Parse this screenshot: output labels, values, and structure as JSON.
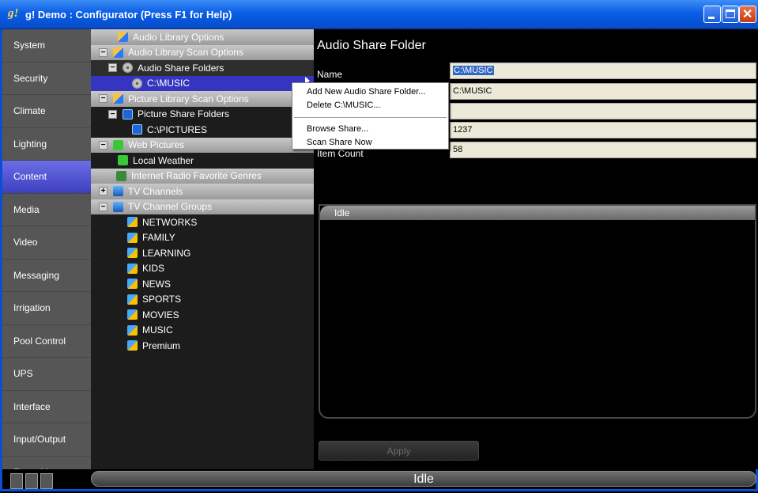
{
  "window": {
    "logo": "g!",
    "title": "g! Demo : Configurator   (Press F1 for Help)",
    "controls": [
      "minimize",
      "maximize",
      "close"
    ]
  },
  "nav": {
    "items": [
      {
        "label": "System"
      },
      {
        "label": "Security"
      },
      {
        "label": "Climate"
      },
      {
        "label": "Lighting"
      },
      {
        "label": "Content",
        "active": true
      },
      {
        "label": "Media"
      },
      {
        "label": "Video"
      },
      {
        "label": "Messaging"
      },
      {
        "label": "Irrigation"
      },
      {
        "label": "Pool Control"
      },
      {
        "label": "UPS"
      },
      {
        "label": "Interface"
      },
      {
        "label": "Input/Output"
      },
      {
        "label": "Event Mapper"
      }
    ]
  },
  "tree": {
    "rows": [
      {
        "label": "Audio Library Options",
        "style": "hdr",
        "indent": 34,
        "icon": "folder-icon"
      },
      {
        "label": "Audio Library Scan Options",
        "style": "hdr",
        "indent": 10,
        "expander": "−",
        "icon": "folder-icon"
      },
      {
        "label": "Audio Share Folders",
        "style": "subhdr",
        "indent": 22,
        "expander": "−",
        "icon": "cd-icon"
      },
      {
        "label": "C:\\MUSIC",
        "style": "sel",
        "indent": 52,
        "icon": "cd-icon"
      },
      {
        "label": "Picture Library Scan Options",
        "style": "hdr",
        "indent": 10,
        "expander": "−",
        "icon": "folder-icon"
      },
      {
        "label": "Picture Share Folders",
        "style": "plain",
        "indent": 22,
        "expander": "−",
        "icon": "picture-icon"
      },
      {
        "label": "C:\\PICTURES",
        "style": "plain",
        "indent": 52,
        "icon": "picture-icon"
      },
      {
        "label": "Web Pictures",
        "style": "hdr",
        "indent": 10,
        "expander": "−",
        "icon": "web-icon"
      },
      {
        "label": "Local Weather",
        "style": "plain",
        "indent": 34,
        "icon": "web-icon"
      },
      {
        "label": "Internet Radio Favorite Genres",
        "style": "hdr",
        "indent": 32,
        "icon": "radio-icon"
      },
      {
        "label": "TV Channels",
        "style": "hdr",
        "indent": 10,
        "expander": "+",
        "icon": "tv-icon"
      },
      {
        "label": "TV Channel Groups",
        "style": "hdr",
        "indent": 10,
        "expander": "−",
        "icon": "tv-icon"
      },
      {
        "label": "NETWORKS",
        "style": "plain",
        "indent": 46,
        "icon": "network-icon"
      },
      {
        "label": "FAMILY",
        "style": "plain",
        "indent": 46,
        "icon": "network-icon"
      },
      {
        "label": "LEARNING",
        "style": "plain",
        "indent": 46,
        "icon": "network-icon"
      },
      {
        "label": "KIDS",
        "style": "plain",
        "indent": 46,
        "icon": "network-icon"
      },
      {
        "label": "NEWS",
        "style": "plain",
        "indent": 46,
        "icon": "network-icon"
      },
      {
        "label": "SPORTS",
        "style": "plain",
        "indent": 46,
        "icon": "network-icon"
      },
      {
        "label": "MOVIES",
        "style": "plain",
        "indent": 46,
        "icon": "network-icon"
      },
      {
        "label": "MUSIC",
        "style": "plain",
        "indent": 46,
        "icon": "network-icon"
      },
      {
        "label": "Premium",
        "style": "plain",
        "indent": 46,
        "icon": "network-icon"
      }
    ]
  },
  "detail": {
    "heading": "Audio Share Folder",
    "fields": [
      {
        "label": "Name",
        "value": "C:\\MUSIC",
        "selected": true
      },
      {
        "label": "",
        "value": "C:\\MUSIC"
      },
      {
        "label": "",
        "value": ""
      },
      {
        "label": "",
        "value": "1237"
      },
      {
        "label": "Item Count",
        "value": "58"
      }
    ],
    "log_title": "Idle",
    "apply_label": "Apply"
  },
  "context_menu": {
    "items": [
      {
        "label": "Add New Audio Share Folder..."
      },
      {
        "label": "Delete C:\\MUSIC..."
      },
      {
        "separator": true
      },
      {
        "label": "Browse Share..."
      },
      {
        "label": "Scan Share Now"
      }
    ]
  },
  "status": {
    "text": "Idle"
  },
  "colors": {
    "titlebar": "#0a5ee6",
    "nav_active": "#4a4cd0",
    "selected_row": "#3535c0",
    "field_bg": "#ece9d8"
  }
}
